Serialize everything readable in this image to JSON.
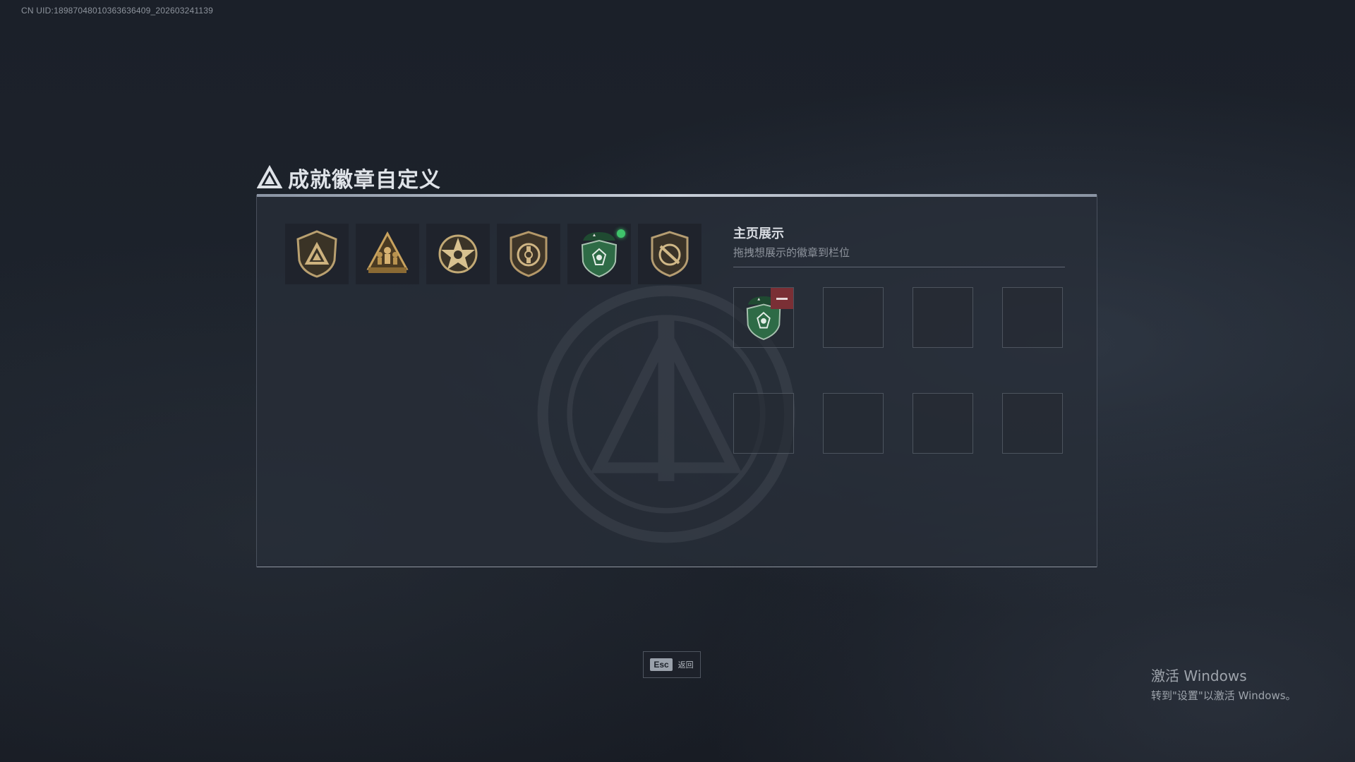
{
  "uid_text": "CN UID:18987048010363636409_202603241139",
  "header": {
    "icon": "triangle-logo-icon",
    "title": "成就徽章自定义"
  },
  "badge_list": [
    {
      "icon": "triangle-shield-badge-icon",
      "color": "#b9a070"
    },
    {
      "icon": "soldiers-triangle-badge-icon",
      "color": "#c8a25e"
    },
    {
      "icon": "star-medal-badge-icon",
      "color": "#c2a975"
    },
    {
      "icon": "round-emblem-badge-icon",
      "color": "#b49869"
    },
    {
      "icon": "green-beret-shield-badge-icon",
      "color": "#2e6b46",
      "new_dot": true
    },
    {
      "icon": "slashed-circle-shield-badge-icon",
      "color": "#b59d72"
    }
  ],
  "display_panel": {
    "title": "主页展示",
    "subtitle": "拖拽想展示的徽章到栏位",
    "slots": [
      {
        "filled": true,
        "icon": "green-beret-shield-badge-icon"
      },
      {
        "filled": false
      },
      {
        "filled": false
      },
      {
        "filled": false
      },
      {
        "filled": false
      },
      {
        "filled": false
      },
      {
        "filled": false
      },
      {
        "filled": false
      }
    ]
  },
  "footer": {
    "esc_key": "Esc",
    "esc_label": "返回"
  },
  "windows_watermark": {
    "line1": "激活 Windows",
    "line2": "转到\"设置\"以激活 Windows。"
  }
}
